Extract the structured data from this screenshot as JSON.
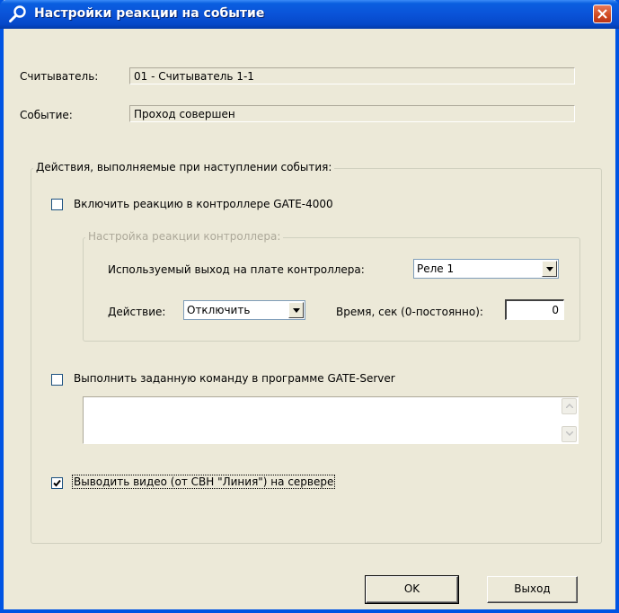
{
  "window": {
    "title": "Настройки реакции на событие",
    "icon": "wrench-icon",
    "close_icon": "close-icon"
  },
  "reader": {
    "label": "Считыватель:",
    "value": "01 - Считыватель 1-1"
  },
  "event": {
    "label": "Событие:",
    "value": "Проход совершен"
  },
  "actions_group": {
    "title": "Действия, выполняемые при наступлении события:",
    "controller": {
      "checkbox_label": "Включить реакцию в контроллере GATE-4000",
      "checked": false,
      "subgroup_title": "Настройка реакции контроллера:",
      "output_label": "Используемый выход на плате контроллера:",
      "output_value": "Реле 1",
      "action_label": "Действие:",
      "action_value": "Отключить",
      "time_label": "Время, сек (0-постоянно):",
      "time_value": "0"
    },
    "command": {
      "checkbox_label": "Выполнить заданную команду в программе GATE-Server",
      "checked": false,
      "text": ""
    },
    "video": {
      "checkbox_label": "Выводить видео (от СВН \"Линия\") на сервере",
      "checked": true
    }
  },
  "buttons": {
    "ok": "OK",
    "exit": "Выход"
  },
  "colors": {
    "title_bar": "#0a53d8",
    "face": "#ece9d8",
    "disabled_text": "#aca899",
    "close": "#cf4a1f"
  }
}
